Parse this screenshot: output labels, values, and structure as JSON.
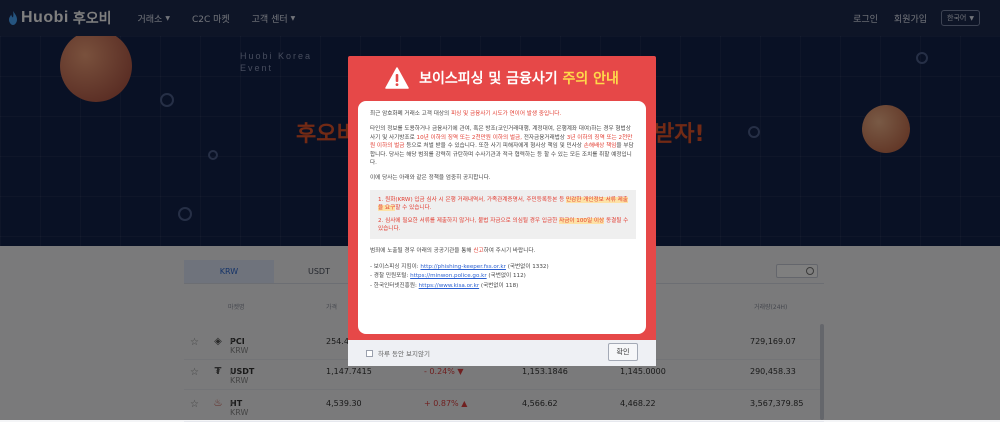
{
  "header": {
    "logo_text": "Huobi",
    "logo_kr": "후오비",
    "nav": [
      "거래소",
      "C2C 마켓",
      "고객 센터"
    ],
    "login": "로그인",
    "signup": "회원가입",
    "language": "한국어"
  },
  "hero": {
    "event_line1": "Huobi Korea",
    "event_line2": "Event",
    "heading_left": "후오비",
    "heading_right": "받자!"
  },
  "market": {
    "tabs": [
      "KRW",
      "USDT"
    ],
    "active_tab": "KRW",
    "columns": [
      "마켓명",
      "가격",
      "거래량(24H)"
    ],
    "rows": [
      {
        "icon": "pci-icon",
        "symbol": "PCI",
        "quote": "/ KRW",
        "price": "254.43",
        "change": "",
        "high": "",
        "low": "",
        "volume": "729,169.07"
      },
      {
        "icon": "tether-icon",
        "symbol": "USDT",
        "quote": "/ KRW",
        "price": "1,147.7415",
        "change": "- 0.24% ▼",
        "high": "1,153.1846",
        "low": "1,145.0000",
        "volume": "290,458.33"
      },
      {
        "icon": "ht-flame-icon",
        "symbol": "HT",
        "quote": "/ KRW",
        "price": "4,539.30",
        "change": "+ 0.87% ▲",
        "high": "4,566.62",
        "low": "4,468.22",
        "volume": "3,567,379.85"
      }
    ]
  },
  "modal": {
    "title_main": "보이스피싱 및 금융사기 ",
    "title_highlight": "주의 안내",
    "p1_a": "최근 암호화폐 거래소 고객 대상의 ",
    "p1_b": "피싱 및 금융사기 시도가 연이어 발생 중입니다.",
    "p2_a": "타인의 정보를 도용하거나 금융사기에 관여, 혹은 방조(코인거래대행, 계정대여, 은행계좌 대여)하는 경우 형법상 사기 및 사기방조로 ",
    "p2_b": "10년 이하의 징역 또는 2천만원 이하의 벌금,",
    "p2_c": " 전자금융거래법상 ",
    "p2_d": "3년 이하의 징역 또는 2천만원 이하의 벌금",
    "p2_e": " 등으로 처벌 받을 수 있습니다. 또한 사기 피해자에게 형사상 책임 및 민사상 ",
    "p2_f": "손해배상 책임",
    "p2_g": "을 부담합니다. 당사는 해당 범죄를 강력히 규탄하며 수사기관과 적극 협력하는 등 할 수 있는 모든 조치를 취할 예정입니다.",
    "p3": "이에 당사는 아래와 같은 정책을 엄중히 공지합니다.",
    "policy1_a": "1. 원화(KRW) 입금 심사 시 은행 거래내역서, 가족관계증명서, 주민등록등본 등 ",
    "policy1_b": "민감한 개인정보 서류 제출을 요구",
    "policy1_c": "할 수 있습니다.",
    "policy2_a": "2. 심사에 필요한 서류를 제출하지 않거나, 불법 자금으로 의심될 경우 입금한 ",
    "policy2_b": "자금이 100일 이상",
    "policy2_c": " 동결될 수 있습니다.",
    "p4_a": "범죄에 노출될 경우 아래의 공공기관을 통해 ",
    "p4_b": "신고",
    "p4_c": "하여 주시기 바랍니다.",
    "contacts": [
      {
        "label": "- 보이스피싱 지킴이: ",
        "url": "http://phishing-keeper.fss.or.kr",
        "note": " (국번없이 1332)"
      },
      {
        "label": "- 경찰 민원포털: ",
        "url": "https://minwon.police.go.kr",
        "note": " (국번없이 112)"
      },
      {
        "label": "- 한국인터넷진흥원: ",
        "url": "https://www.kisa.or.kr",
        "note": " (국번없이 118)"
      }
    ],
    "dismiss_label": "하루 동안 보지않기",
    "confirm_label": "확인"
  },
  "colors": {
    "modal_red": "#e64848",
    "title_highlight": "#ffd94a",
    "header_navy": "#1d2b4f",
    "hero_accent": "#e5542a"
  }
}
